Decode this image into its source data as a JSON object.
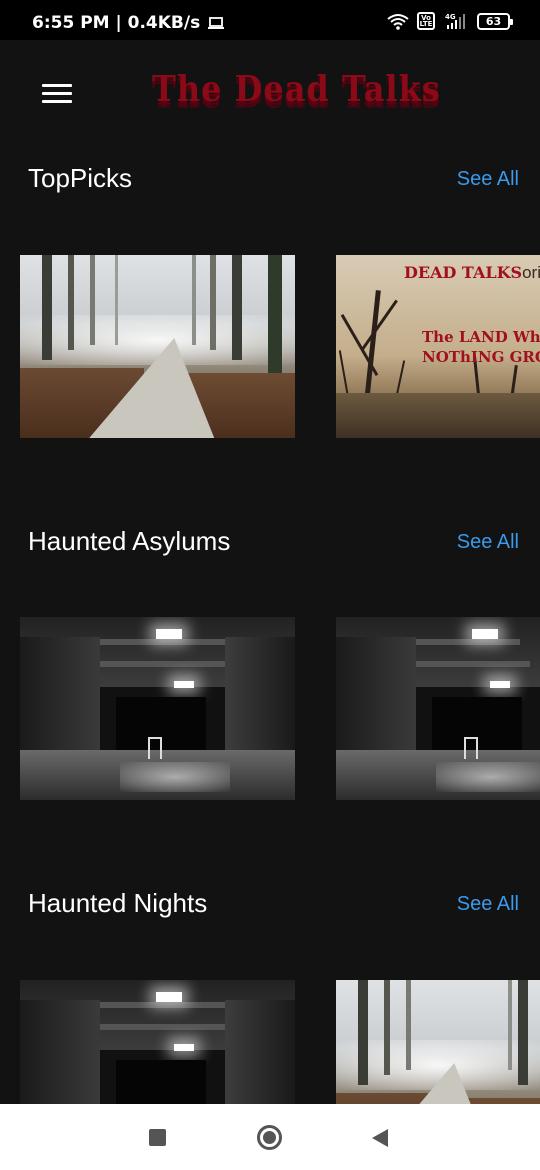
{
  "status_bar": {
    "time": "6:55 PM | 0.4KB/s",
    "network_type": "4G",
    "volte": "Vo LTE",
    "battery": "63",
    "icons": [
      "laptop-icon",
      "wifi-icon",
      "volte-icon",
      "signal-icon",
      "battery-icon"
    ]
  },
  "app_bar": {
    "menu_icon": "hamburger-menu-icon",
    "logo_text": "The Dead Talks"
  },
  "sections": [
    {
      "title": "TopPicks",
      "see_all": "See All",
      "items": [
        {
          "image": "foggy-forest-path"
        },
        {
          "image": "dead-talks-original-poster",
          "brand": "DEAD TALKS",
          "brand_suffix": "origina",
          "tagline_line1": "The LAND WheRe",
          "tagline_line2": "NOThING GROWS"
        }
      ]
    },
    {
      "title": "Haunted Asylums",
      "see_all": "See All",
      "items": [
        {
          "image": "abandoned-asylum-corridor"
        },
        {
          "image": "abandoned-asylum-corridor"
        }
      ]
    },
    {
      "title": "Haunted Nights",
      "see_all": "See All",
      "items": [
        {
          "image": "abandoned-asylum-corridor"
        },
        {
          "image": "foggy-forest-path"
        }
      ]
    }
  ],
  "colors": {
    "background": "#121212",
    "accent_link": "#3b9aea",
    "logo_red": "#8b0a17"
  },
  "nav_bar": {
    "buttons": [
      "recents-button",
      "home-button",
      "back-button"
    ]
  }
}
